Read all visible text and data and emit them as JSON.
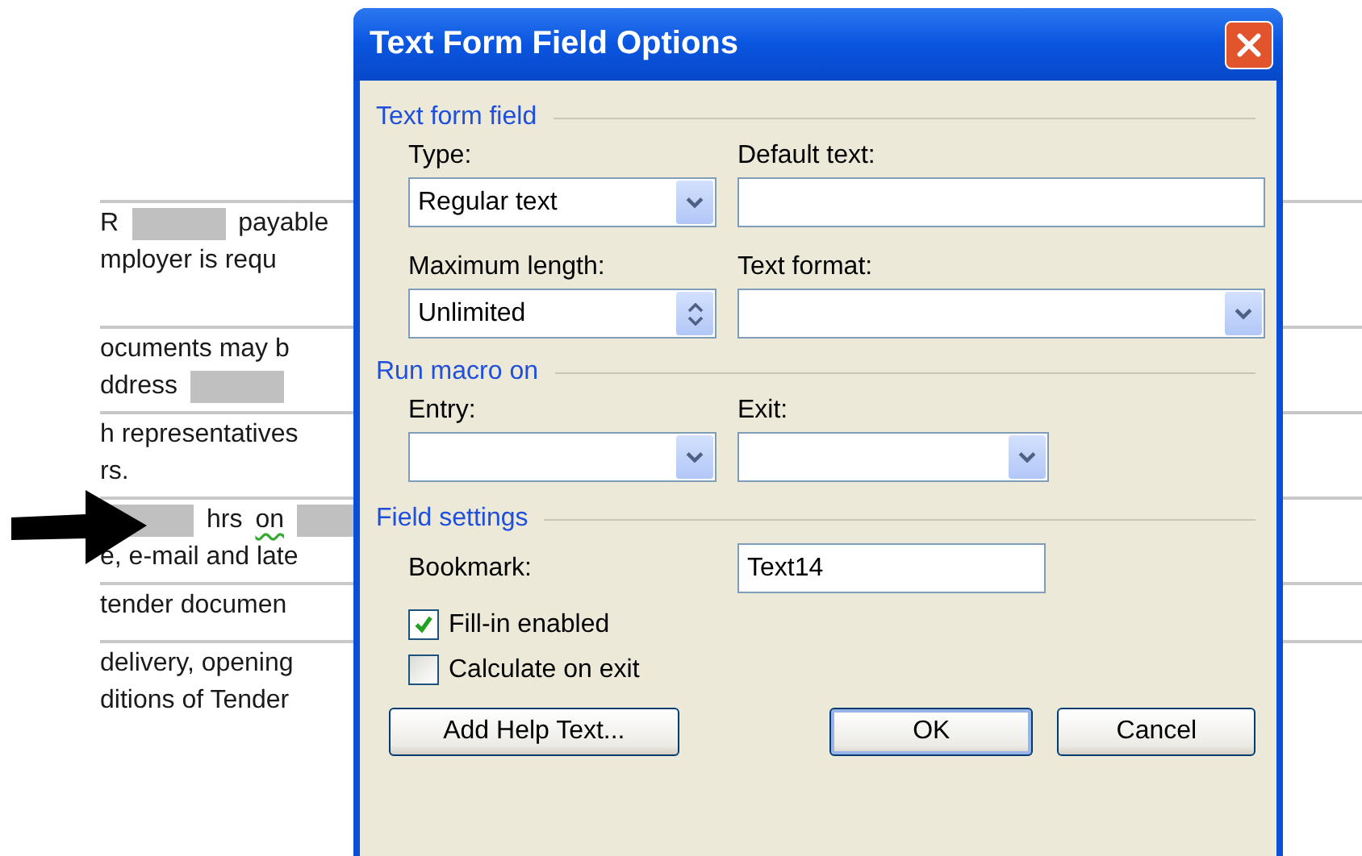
{
  "document": {
    "rows": [
      {
        "lines": [
          [
            {
              "kind": "text",
              "text": "R"
            },
            {
              "kind": "redaction"
            },
            {
              "kind": "text",
              "text": "payable"
            }
          ],
          [
            {
              "kind": "text",
              "text": "mployer is requ"
            }
          ]
        ]
      },
      {
        "lines": [
          [
            {
              "kind": "text",
              "text": "ocuments may b"
            }
          ],
          [
            {
              "kind": "text",
              "text": "ddress"
            },
            {
              "kind": "redaction"
            }
          ]
        ]
      },
      {
        "lines": [
          [
            {
              "kind": "text",
              "text": "h representatives"
            }
          ],
          [
            {
              "kind": "text",
              "text": "rs."
            }
          ]
        ]
      },
      {
        "lines": [
          [
            {
              "kind": "redaction"
            },
            {
              "kind": "text",
              "text": "hrs"
            },
            {
              "kind": "flagged",
              "text": "on"
            },
            {
              "kind": "redaction"
            }
          ],
          [
            {
              "kind": "text",
              "text": "e, e-mail and late"
            }
          ]
        ]
      },
      {
        "lines": [
          [
            {
              "kind": "text",
              "text": "tender documen"
            }
          ]
        ]
      },
      {
        "lines": [
          [
            {
              "kind": "text",
              "text": "delivery, opening"
            }
          ],
          [
            {
              "kind": "text",
              "text": "ditions of Tender"
            }
          ]
        ]
      }
    ]
  },
  "dialog": {
    "title": "Text Form Field Options",
    "text_form_field": {
      "title": "Text form field",
      "type": {
        "label": "Type:",
        "value": "Regular text"
      },
      "default_text": {
        "label": "Default text:"
      },
      "maximum_length": {
        "label": "Maximum length:",
        "value": "Unlimited"
      },
      "text_format": {
        "label": "Text format:"
      }
    },
    "run_macro_on": {
      "title": "Run macro on",
      "entry": {
        "label": "Entry:"
      },
      "exit": {
        "label": "Exit:"
      }
    },
    "field_settings": {
      "title": "Field settings",
      "bookmark": {
        "label": "Bookmark:",
        "value": "Text14"
      },
      "checkboxes": [
        {
          "label": "Fill-in enabled",
          "checked": true
        },
        {
          "label": "Calculate on exit",
          "checked": false
        }
      ]
    },
    "buttons": [
      {
        "label": "Add Help Text...",
        "default": false
      },
      {
        "label": "OK",
        "default": true
      },
      {
        "label": "Cancel",
        "default": false
      }
    ]
  }
}
